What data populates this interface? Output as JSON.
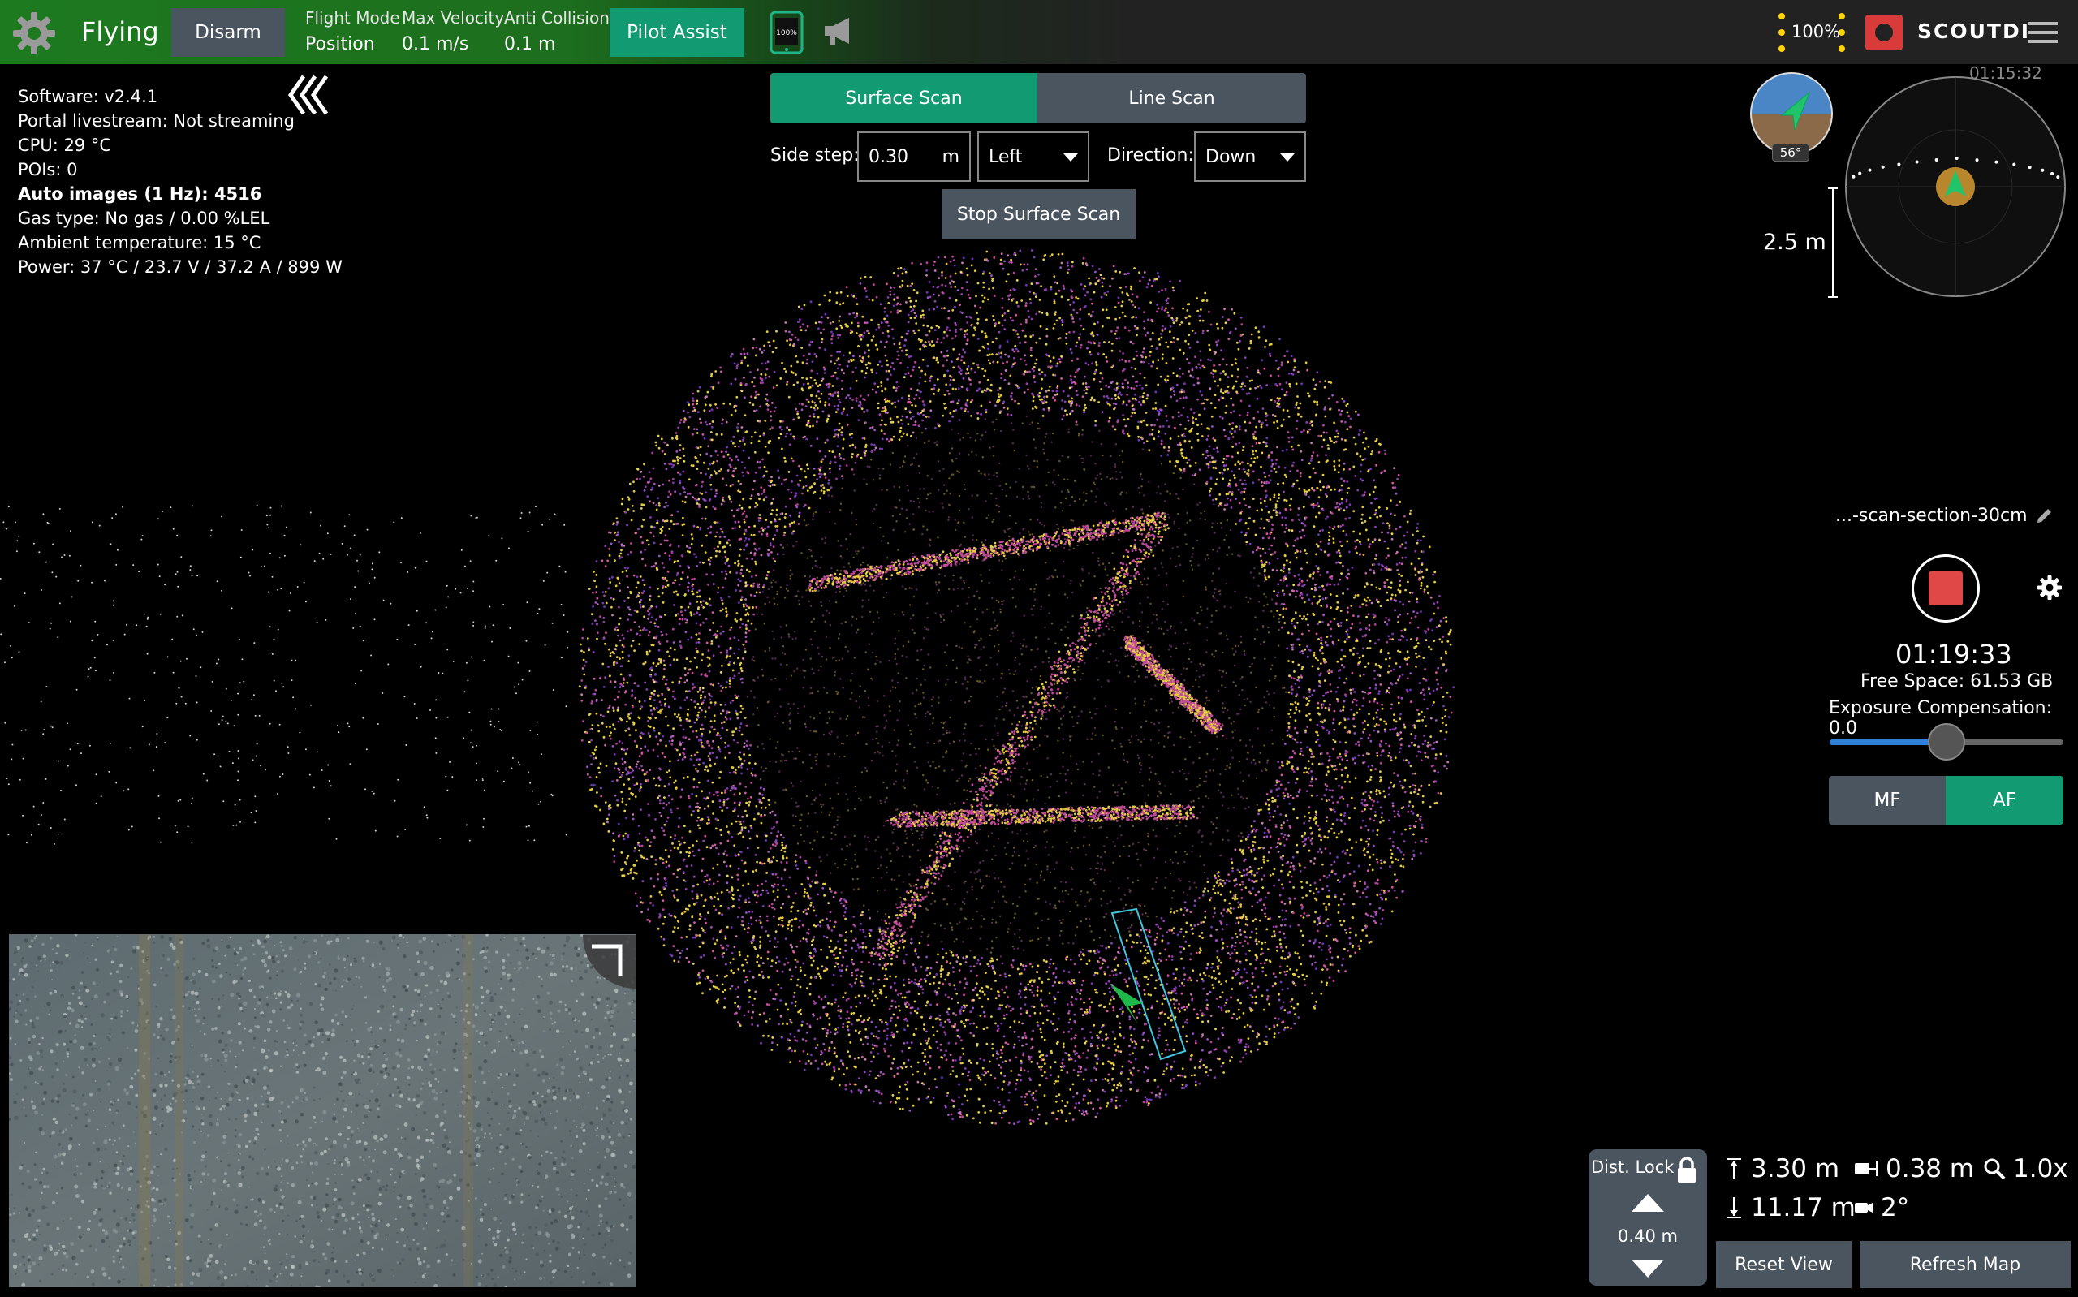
{
  "header": {
    "state": "Flying",
    "disarm_label": "Disarm",
    "flight_mode": {
      "label": "Flight Mode",
      "value": "Position"
    },
    "max_velocity": {
      "label": "Max Velocity",
      "value": "0.1 m/s"
    },
    "anti_collision": {
      "label": "Anti Collision",
      "value": "0.1 m"
    },
    "pilot_assist_label": "Pilot Assist",
    "tablet_battery": "100%",
    "drone_battery": "100%",
    "logo": "SCOUTDI",
    "clock": "01:15:32",
    "accent_green": "#129b72",
    "bar_green": "#1d7a1f"
  },
  "status": {
    "software": "Software: v2.4.1",
    "portal": "Portal livestream: Not streaming",
    "cpu": "CPU: 29 °C",
    "pois": "POIs: 0",
    "auto_images": "Auto images (1 Hz): 4516",
    "gas": "Gas type: No gas / 0.00 %LEL",
    "ambient": "Ambient temperature: 15 °C",
    "power": "Power: 37 °C / 23.7 V / 37.2 A / 899 W"
  },
  "scan": {
    "tabs": [
      "Surface Scan",
      "Line Scan"
    ],
    "active_tab": "Surface Scan",
    "side_step_label": "Side step:",
    "side_step_value": "0.30",
    "side_step_unit": "m",
    "side_value": "Left",
    "direction_label": "Direction:",
    "direction_value": "Down",
    "stop_label": "Stop Surface Scan"
  },
  "nav": {
    "heading": "56°",
    "scale": "2.5 m"
  },
  "camera": {
    "filename": "...-scan-section-30cm",
    "timer": "01:19:33",
    "free_space": "Free Space: 61.53 GB",
    "exposure": "Exposure Compensation: 0.0",
    "exposure_level": 0.5,
    "focus_modes": [
      "MF",
      "AF"
    ],
    "active_focus": "AF",
    "record_color": "#e04848"
  },
  "distance": {
    "lock_label": "Dist. Lock",
    "value": "0.40 m",
    "up": "3.30 m",
    "down": "11.17 m",
    "front": "0.38 m",
    "zoom": "1.0x",
    "tilt": "2°"
  },
  "actions": {
    "reset": "Reset View",
    "refresh": "Refresh Map"
  }
}
